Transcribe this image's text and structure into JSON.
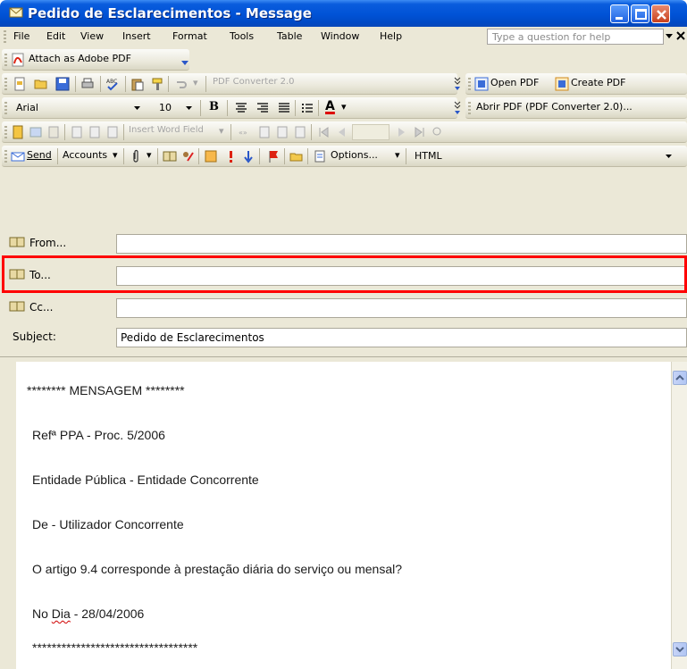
{
  "window": {
    "title": "Pedido de Esclarecimentos - Message"
  },
  "menubar": {
    "items": [
      "File",
      "Edit",
      "View",
      "Insert",
      "Format",
      "Tools",
      "Table",
      "Window",
      "Help"
    ],
    "help_placeholder": "Type a question for help"
  },
  "toolbar_adobe": {
    "attach_label": "Attach as Adobe PDF"
  },
  "toolbar_standard": {
    "pdf_converter_label": "PDF Converter 2.0",
    "open_pdf_label": "Open PDF",
    "create_pdf_label": "Create PDF"
  },
  "toolbar_format": {
    "font_name": "Arial",
    "font_size": "10",
    "bold_label": "B",
    "font_color_label": "A",
    "abrir_pdf_label": "Abrir PDF (PDF Converter 2.0)..."
  },
  "toolbar_mail_merge": {
    "insert_word_field_label": "Insert Word Field"
  },
  "toolbar_email": {
    "send_label": "Send",
    "accounts_label": "Accounts",
    "options_label": "Options...",
    "format_label": "HTML"
  },
  "header": {
    "from_label": "From...",
    "to_label": "To...",
    "cc_label": "Cc...",
    "subject_label": "Subject:",
    "from_value": "",
    "to_value": "",
    "cc_value": "",
    "subject_value": "Pedido de Esclarecimentos"
  },
  "body": {
    "line1": "******** MENSAGEM ********",
    "line2": "Refª PPA - Proc. 5/2006",
    "line3": "Entidade Pública - Entidade Concorrente",
    "line4": "De - Utilizador Concorrente",
    "line5": "O artigo 9.4 corresponde à prestação diária do serviço ou mensal?",
    "line6_prefix": "No ",
    "line6_spell": "Dia",
    "line6_suffix": " - 28/04/2006",
    "line7": "**********************************"
  },
  "colors": {
    "titlebar": "#0052d6",
    "toolbar_bg": "#ebe8d7",
    "highlight_border": "#ff0000"
  }
}
